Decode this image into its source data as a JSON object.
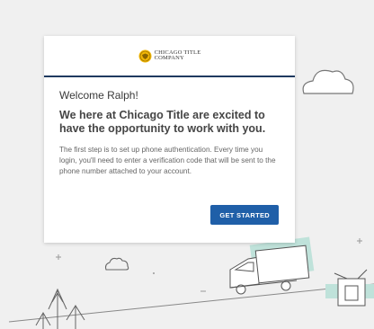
{
  "logo": {
    "name": "CHICAGO TITLE\nCOMPANY",
    "icon": "eagle-seal-icon",
    "color": "#f2b705"
  },
  "card": {
    "welcome": "Welcome Ralph!",
    "headline": "We here at Chicago Title are excited to have the opportunity to work with you.",
    "description": "The first step is to set up phone authentication. Every time you login, you'll need to enter a verification code that will be sent to the phone number attached to your account.",
    "button_label": "GET STARTED"
  },
  "colors": {
    "accent": "#1f5fa8",
    "header_rule": "#1f3a5f",
    "illustration_teal": "#bfe2da"
  }
}
